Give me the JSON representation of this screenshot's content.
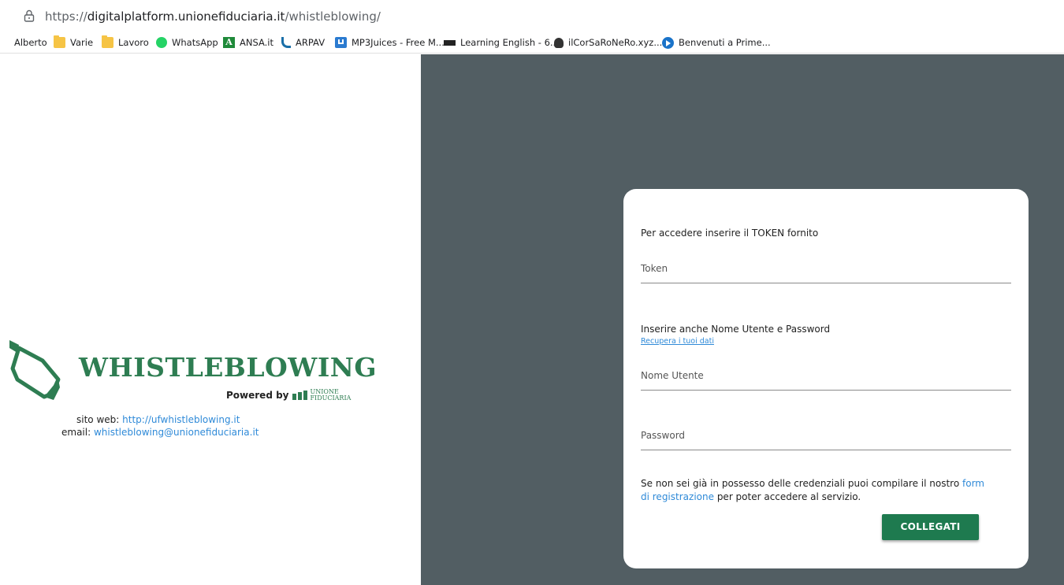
{
  "browser": {
    "url_prefix": "https://",
    "url_host": "digitalplatform.unionefiduciaria.it",
    "url_path": "/whistleblowing/",
    "bookmarks": [
      {
        "label": "Alberto",
        "icon": "none"
      },
      {
        "label": "Varie",
        "icon": "folder-icon"
      },
      {
        "label": "Lavoro",
        "icon": "folder-icon"
      },
      {
        "label": "WhatsApp",
        "icon": "whatsapp-icon"
      },
      {
        "label": "ANSA.it",
        "icon": "ansa-icon"
      },
      {
        "label": "ARPAV",
        "icon": "arpav-icon"
      },
      {
        "label": "MP3Juices - Free M...",
        "icon": "download-icon"
      },
      {
        "label": "Learning English - 6...",
        "icon": "bbc-icon"
      },
      {
        "label": "ilCorSaRoNeRo.xyz...",
        "icon": "skull-icon"
      },
      {
        "label": "Benvenuti a Prime...",
        "icon": "play-icon"
      }
    ]
  },
  "brand": {
    "title": "WHISTLEBLOWING",
    "powered_by": "Powered by",
    "company_line1": "UNIONE",
    "company_line2": "FIDUCIARIA",
    "primary_color": "#2e7d52"
  },
  "contact": {
    "web_label": "sito web:",
    "web_link": "http://ufwhistleblowing.it",
    "email_label": "email:",
    "email_link": "whistleblowing@unionefiduciaria.it",
    "link_color": "#2f8ad8"
  },
  "login": {
    "token_intro": "Per accedere inserire il TOKEN fornito",
    "token_placeholder": "Token",
    "credentials_intro": "Inserire anche Nome Utente e Password",
    "recover_link": "Recupera i tuoi dati",
    "username_placeholder": "Nome Utente",
    "password_placeholder": "Password",
    "register_text_before": "Se non sei già in possesso delle credenziali puoi compilare il nostro",
    "register_link": "form di registrazione",
    "register_text_after": "per poter accedere al servizio.",
    "submit_label": "COLLEGATI",
    "submit_color": "#1e7a4f",
    "panel_bg": "#525e63"
  }
}
